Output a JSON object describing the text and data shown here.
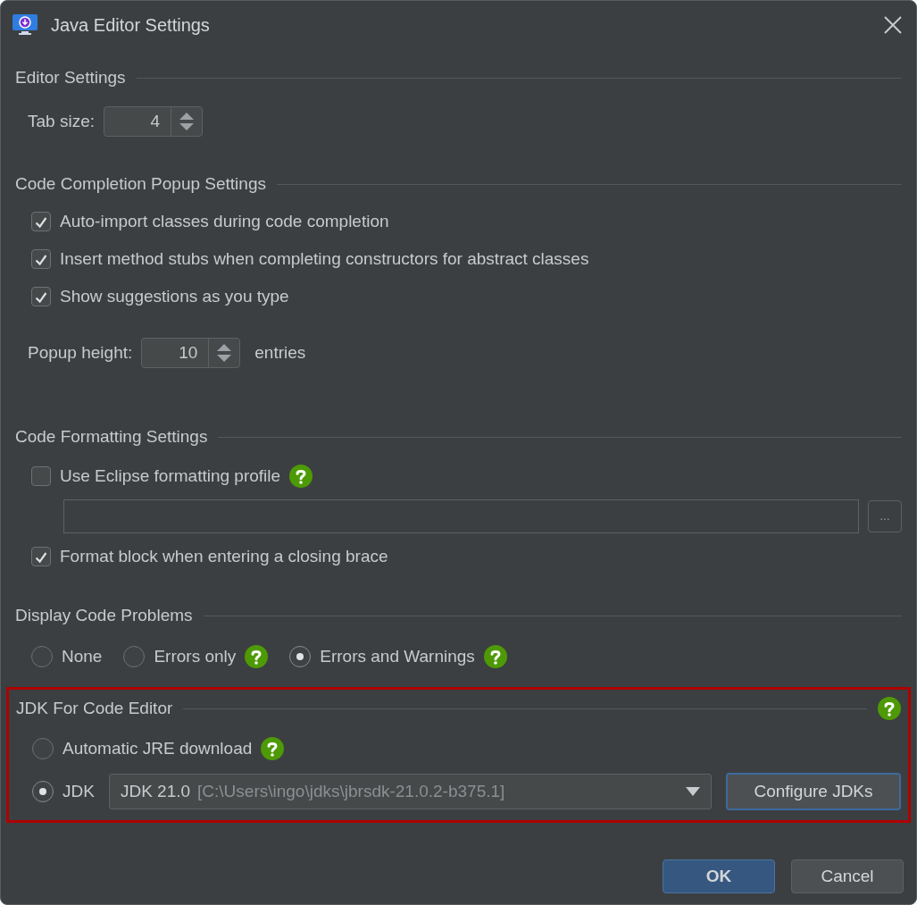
{
  "window": {
    "title": "Java Editor Settings"
  },
  "editor_settings": {
    "heading": "Editor Settings",
    "tab_size": {
      "label": "Tab size:",
      "value": "4"
    }
  },
  "code_completion": {
    "heading": "Code Completion Popup Settings",
    "options": [
      {
        "label": "Auto-import classes during code completion",
        "checked": true
      },
      {
        "label": "Insert method stubs when completing constructors for abstract classes",
        "checked": true
      },
      {
        "label": "Show suggestions as you type",
        "checked": true
      }
    ],
    "popup_height": {
      "label": "Popup height:",
      "value": "10",
      "unit": "entries"
    }
  },
  "code_formatting": {
    "heading": "Code Formatting Settings",
    "eclipse_profile": {
      "label": "Use Eclipse formatting profile",
      "checked": false,
      "help": true
    },
    "browse_button": "…",
    "format_block": {
      "label": "Format block when entering a closing brace",
      "checked": true
    }
  },
  "display_code_problems": {
    "heading": "Display Code Problems",
    "options": [
      {
        "label": "None",
        "selected": false
      },
      {
        "label": "Errors only",
        "selected": false,
        "help": true
      },
      {
        "label": "Errors and Warnings",
        "selected": true,
        "help": true
      }
    ]
  },
  "jdk_section": {
    "heading": "JDK For Code Editor",
    "highlighted": true,
    "help": true,
    "options": [
      {
        "kind": "auto",
        "label": "Automatic JRE download",
        "selected": false,
        "help": true
      },
      {
        "kind": "jdk",
        "label": "JDK",
        "selected": true
      }
    ],
    "jdk_dropdown": {
      "name": "JDK 21.0",
      "path": "[C:\\Users\\ingo\\jdks\\jbrsdk-21.0.2-b375.1]"
    },
    "configure_button": "Configure JDKs"
  },
  "buttons": [
    {
      "label": "OK",
      "kind": "primary"
    },
    {
      "label": "Cancel",
      "kind": "secondary"
    }
  ]
}
